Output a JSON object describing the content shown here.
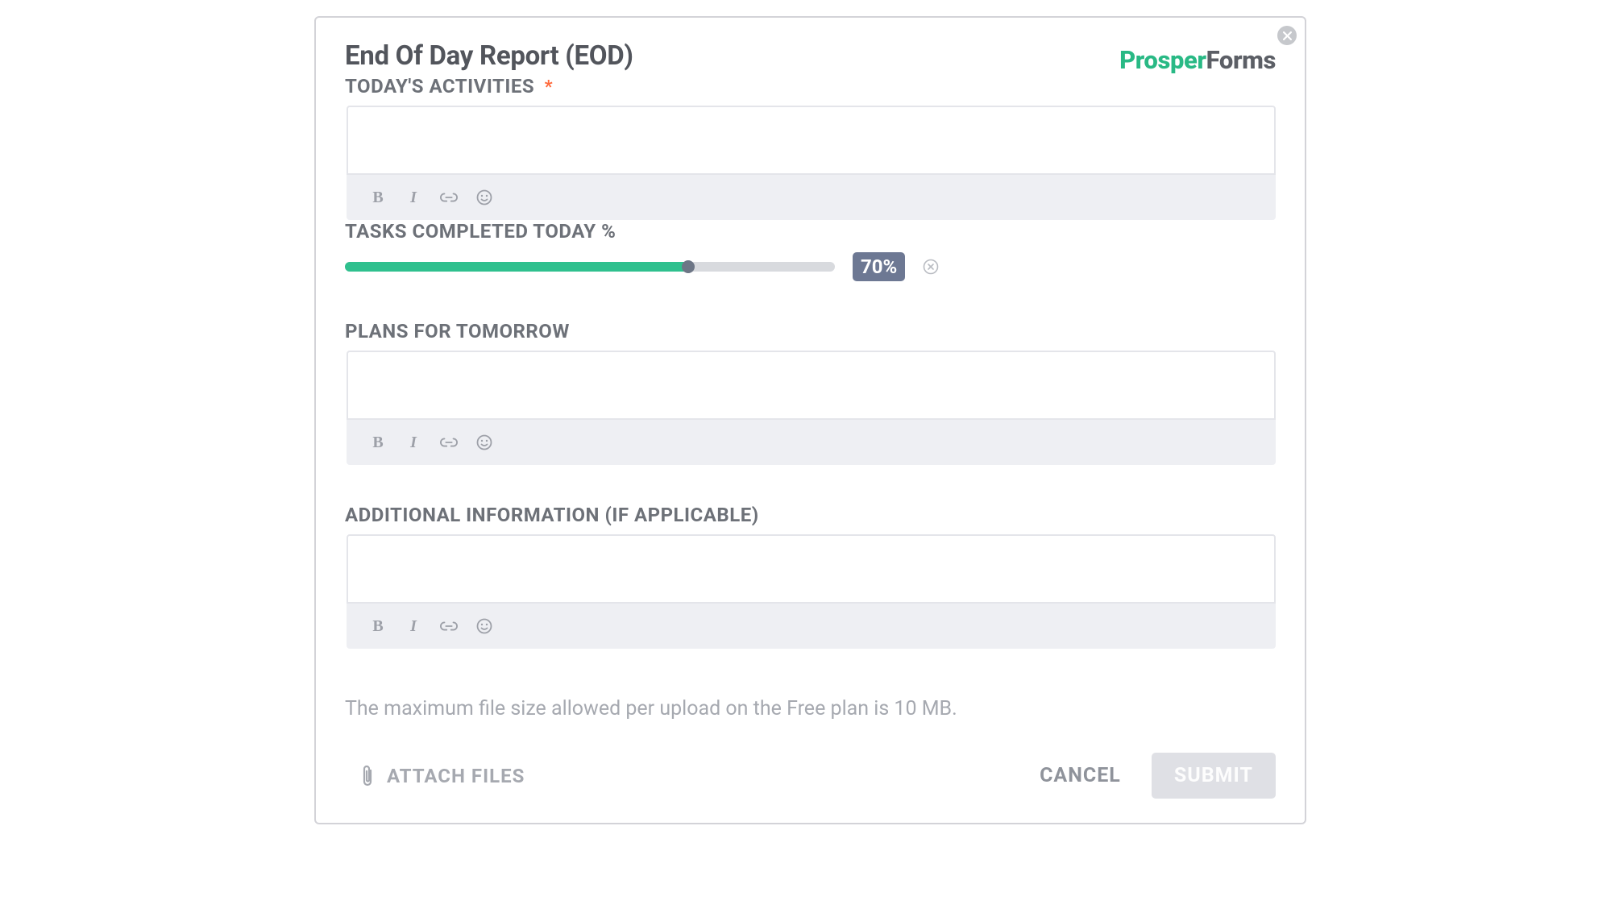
{
  "form": {
    "title": "End Of Day Report (EOD)",
    "brand_first": "Prosper",
    "brand_second": "Forms"
  },
  "fields": {
    "activities": {
      "label": "TODAY'S ACTIVITIES",
      "required_marker": "*"
    },
    "tasks_pct": {
      "label": "TASKS COMPLETED TODAY %",
      "value": 70,
      "display": "70%"
    },
    "plans": {
      "label": "PLANS FOR TOMORROW"
    },
    "additional": {
      "label": "ADDITIONAL INFORMATION (IF APPLICABLE)"
    }
  },
  "file_note": "The maximum file size allowed per upload on the Free plan is 10 MB.",
  "footer": {
    "attach_label": "ATTACH FILES",
    "cancel_label": "CANCEL",
    "submit_label": "SUBMIT"
  }
}
